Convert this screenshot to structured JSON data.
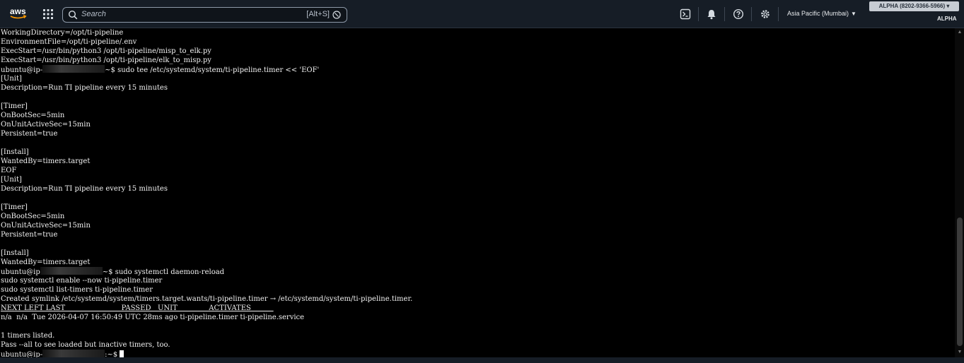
{
  "topbar": {
    "logo_text": "aws",
    "search_placeholder": "Search",
    "search_shortcut": "[Alt+S]",
    "region": "Asia Pacific (Mumbai)",
    "region_caret": "▼",
    "account": "ALPHA (8202-9366-5966) ▾",
    "account_sub": "ALPHA",
    "icons": [
      "services-grid-icon",
      "search-icon",
      "cloudshell-icon",
      "notifications-bell-icon",
      "help-icon",
      "settings-gear-icon"
    ],
    "colors": {
      "bar_bg": "#161d26",
      "text": "#e6e9ec",
      "aws_smile": "#ff9900"
    }
  },
  "terminal": {
    "lines": [
      {
        "a": "WorkingDirectory=/opt/ti-pipeline"
      },
      {
        "a": "EnvironmentFile=/opt/ti-pipeline/.env"
      },
      {
        "a": "ExecStart=/usr/bin/python3 /opt/ti-pipeline/misp_to_elk.py"
      },
      {
        "a": "ExecStart=/usr/bin/python3 /opt/ti-pipeline/elk_to_misp.py"
      },
      {
        "a": "ubuntu@ip-",
        "redact": true,
        "b": "~$ sudo tee /etc/systemd/system/ti-pipeline.timer << 'EOF'"
      },
      {
        "a": "[Unit]"
      },
      {
        "a": "Description=Run TI pipeline every 15 minutes"
      },
      {
        "a": ""
      },
      {
        "a": "[Timer]"
      },
      {
        "a": "OnBootSec=5min"
      },
      {
        "a": "OnUnitActiveSec=15min"
      },
      {
        "a": "Persistent=true"
      },
      {
        "a": ""
      },
      {
        "a": "[Install]"
      },
      {
        "a": "WantedBy=timers.target"
      },
      {
        "a": "EOF"
      },
      {
        "a": "[Unit]"
      },
      {
        "a": "Description=Run TI pipeline every 15 minutes"
      },
      {
        "a": ""
      },
      {
        "a": "[Timer]"
      },
      {
        "a": "OnBootSec=5min"
      },
      {
        "a": "OnUnitActiveSec=15min"
      },
      {
        "a": "Persistent=true"
      },
      {
        "a": ""
      },
      {
        "a": "[Install]"
      },
      {
        "a": "WantedBy=timers.target"
      },
      {
        "a": "ubuntu@ip",
        "redact": true,
        "b": "~$ sudo systemctl daemon-reload"
      },
      {
        "a": "sudo systemctl enable --now ti-pipeline.timer"
      },
      {
        "a": "sudo systemctl list-timers ti-pipeline.timer"
      },
      {
        "a": "Created symlink /etc/systemd/system/timers.target.wants/ti-pipeline.timer → /etc/systemd/system/ti-pipeline.timer."
      },
      {
        "a": "NEXT LEFT LAST                         PASSED   UNIT              ACTIVATES          ",
        "header": true
      },
      {
        "a": "n/a  n/a  Tue 2026-04-07 16:50:49 UTC 28ms ago ti-pipeline.timer ti-pipeline.service"
      },
      {
        "a": ""
      },
      {
        "a": "1 timers listed."
      },
      {
        "a": "Pass --all to see loaded but inactive timers, too."
      },
      {
        "a": "ubuntu@ip-",
        "redact": true,
        "b": ":~$ ",
        "cursor": true
      }
    ]
  }
}
